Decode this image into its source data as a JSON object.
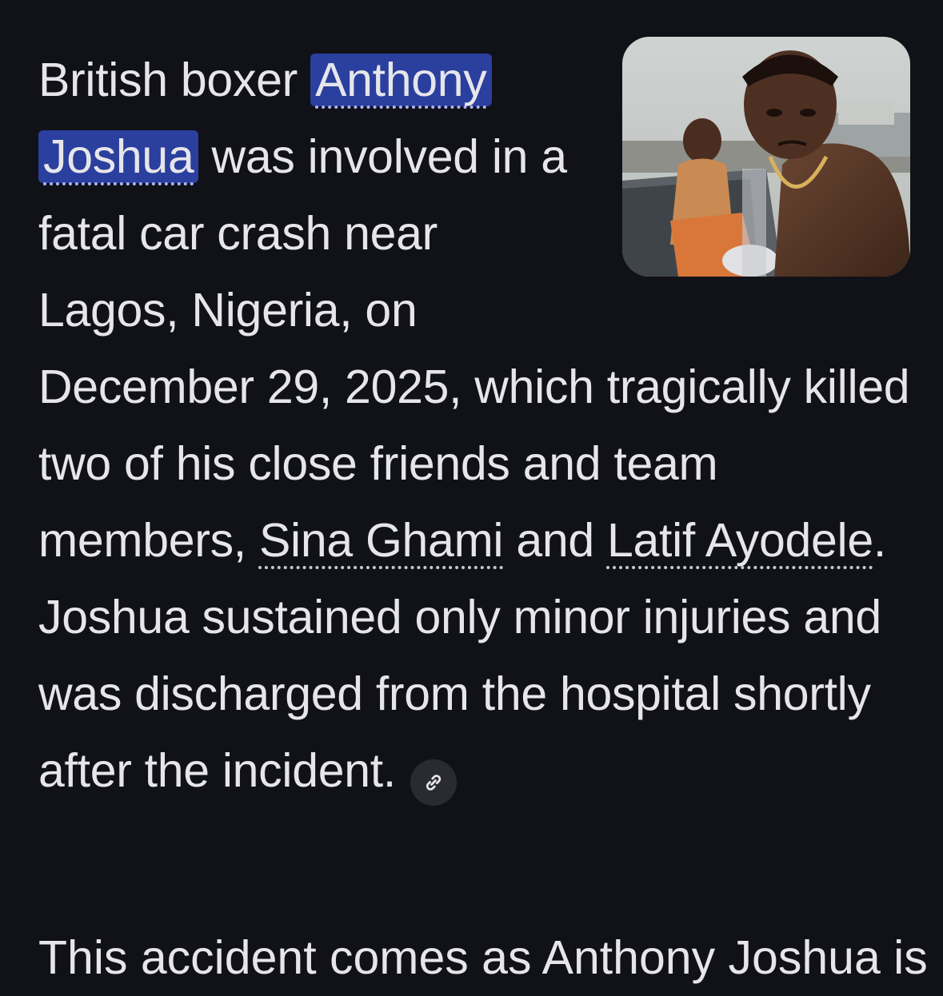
{
  "paragraph": {
    "intro": "British boxer ",
    "entity_1": "Anthony Joshua",
    "after_entity_1": " was involved in a fatal car crash near Lagos, Nigeria, on December 29, 2025, which tragically killed two of his close friends and team members, ",
    "entity_2": "Sina Ghami",
    "between_entities": " and ",
    "entity_3": "Latif Ayodele",
    "closing": ". Joshua sustained only minor injuries and was discharged from the hospital shortly after the incident."
  },
  "citation_icon": "link-icon",
  "next_paragraph_start": "This accident comes as Anthony Joshua is",
  "colors": {
    "background": "#111217",
    "text": "#e6e6ea",
    "highlight": "#2b3f9e",
    "chip": "#2a2b31"
  }
}
